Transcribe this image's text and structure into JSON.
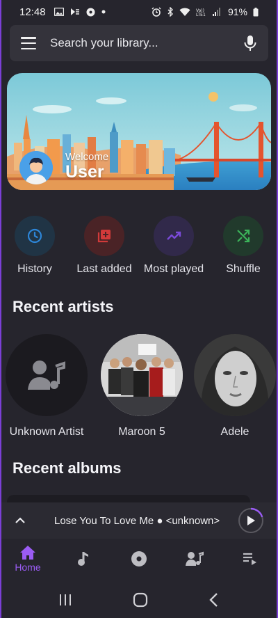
{
  "status_bar": {
    "time": "12:48",
    "battery": "91%",
    "left_icons": [
      "gallery-icon",
      "media-icon",
      "music-app-icon",
      "dot-icon"
    ],
    "right_icons": [
      "alarm-icon",
      "bluetooth-icon",
      "wifi-icon",
      "volte-icon",
      "signal-icon",
      "battery-icon"
    ]
  },
  "search": {
    "placeholder": "Search your library..."
  },
  "banner": {
    "welcome": "Welcome",
    "username": "User"
  },
  "quick_actions": [
    {
      "label": "History",
      "icon": "clock-icon",
      "bg": "#203445",
      "fg": "#2d86d8"
    },
    {
      "label": "Last added",
      "icon": "playlist-add-icon",
      "bg": "#4a2326",
      "fg": "#d23a3a"
    },
    {
      "label": "Most played",
      "icon": "trending-up-icon",
      "bg": "#31294a",
      "fg": "#7a4ad8"
    },
    {
      "label": "Shuffle",
      "icon": "shuffle-icon",
      "bg": "#213a2c",
      "fg": "#3cb35a"
    }
  ],
  "recent_artists": {
    "title": "Recent artists",
    "items": [
      {
        "name": "Unknown Artist"
      },
      {
        "name": "Maroon 5"
      },
      {
        "name": "Adele"
      }
    ]
  },
  "recent_albums": {
    "title": "Recent albums"
  },
  "player": {
    "track": "Lose You To Love Me ● <unknown>",
    "progress": 0.2
  },
  "bottom_nav": [
    {
      "label": "Home",
      "icon": "home-icon",
      "active": true
    },
    {
      "label": "",
      "icon": "song-icon",
      "active": false
    },
    {
      "label": "",
      "icon": "album-icon",
      "active": false
    },
    {
      "label": "",
      "icon": "artist-icon",
      "active": false
    },
    {
      "label": "",
      "icon": "queue-icon",
      "active": false
    }
  ],
  "colors": {
    "background": "#26252d",
    "accent": "#9b5cf5",
    "surface": "#34333b"
  }
}
